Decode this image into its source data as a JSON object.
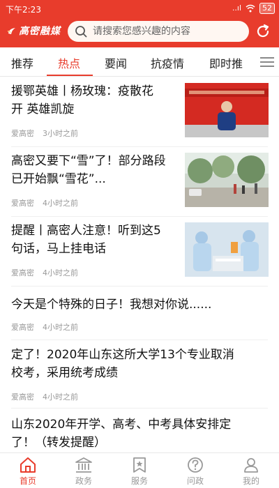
{
  "status_bar": {
    "time": "下午2:23",
    "signal": "..ıl",
    "battery": "52"
  },
  "header": {
    "logo_text": "高密融媒",
    "search_placeholder": "请搜索您感兴趣的内容"
  },
  "tabs": [
    {
      "label": "推荐"
    },
    {
      "label": "热点",
      "active": true
    },
    {
      "label": "要闻"
    },
    {
      "label": "抗疫情"
    },
    {
      "label": "即时推"
    }
  ],
  "feed": [
    {
      "title_line1": "援鄂英雄丨杨玫瑰：疫散花",
      "title_line2": "开 英雄凯旋",
      "source": "爱高密",
      "time": "3小时之前"
    },
    {
      "title_line1": "高密又要下“雪”了！部分路段",
      "title_line2": "已开始飘“雪花”...",
      "source": "爱高密",
      "time": "4小时之前"
    },
    {
      "title_line1": "提醒丨高密人注意！听到这5",
      "title_line2": "句话，马上挂电话",
      "source": "爱高密",
      "time": "4小时之前"
    },
    {
      "title_line1": "今天是个特殊的日子！我想对你说......",
      "source": "爱高密",
      "time": "4小时之前"
    },
    {
      "title_line1": "定了！2020年山东这所大学13个专业取消",
      "title_line2": "校考，采用统考成绩",
      "source": "爱高密",
      "time": "4小时之前"
    },
    {
      "title_line1": "山东2020年开学、高考、中考具体安排定",
      "title_line2": "了！（转发提醒）"
    }
  ],
  "bottom_nav": [
    {
      "label": "首页",
      "active": true
    },
    {
      "label": "政务"
    },
    {
      "label": "服务"
    },
    {
      "label": "问政"
    },
    {
      "label": "我的"
    }
  ],
  "colors": {
    "brand_red": "#e83c2c",
    "muted_gray": "#999999"
  },
  "icons": [
    "logo-mark-icon",
    "search-icon",
    "refresh-icon",
    "menu-icon",
    "home-icon",
    "government-icon",
    "service-icon",
    "question-icon",
    "profile-icon"
  ]
}
